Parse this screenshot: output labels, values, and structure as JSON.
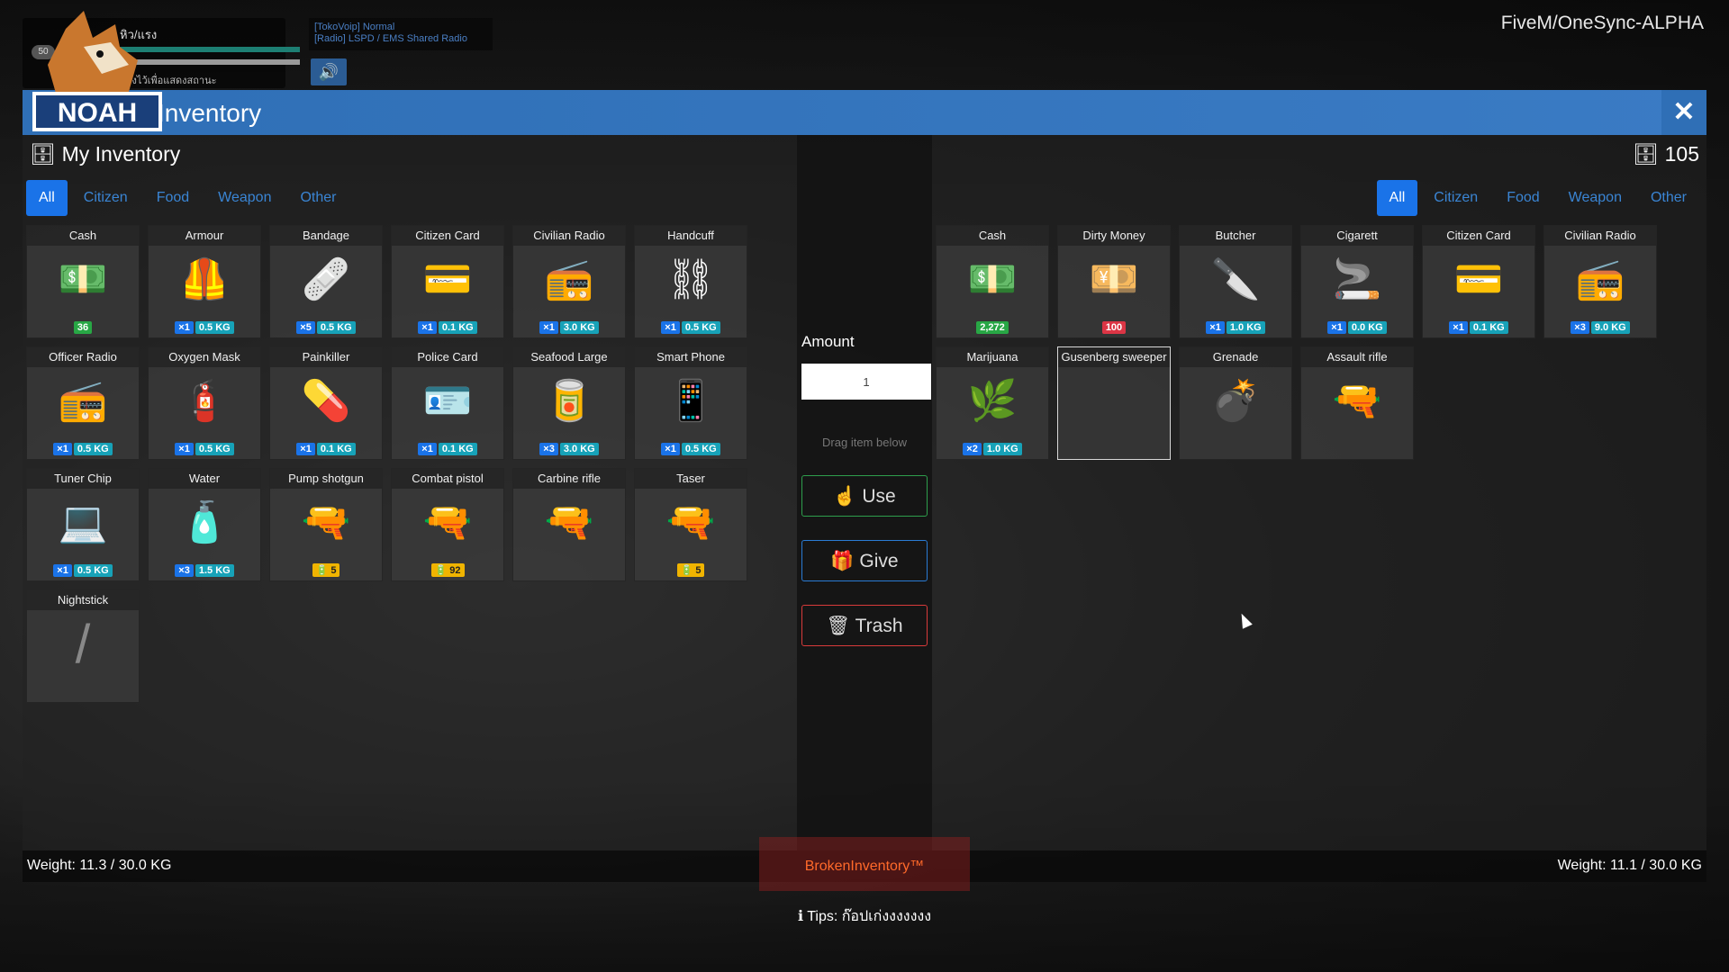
{
  "hud": {
    "hunger_label": "หิว/แรง",
    "mic_label": "50",
    "status_text": "ค้างไว้เพื่อแสดงสถานะ",
    "radio_line1": "[TokoVoip] Normal",
    "radio_line2": "[Radio] LSPD / EMS Shared Radio",
    "speaker_icon": "speaker-icon",
    "server_name": "FiveM/OneSync-ALPHA"
  },
  "window": {
    "logo_text": "NOAH",
    "title": "Inventory",
    "close_label": "✕"
  },
  "left": {
    "title": "My Inventory",
    "tabs": [
      "All",
      "Citizen",
      "Food",
      "Weapon",
      "Other"
    ],
    "active_tab": "All",
    "items": [
      {
        "name": "Cash",
        "icon": "cash-icon",
        "glyph": "💵",
        "badges": [
          {
            "t": "green",
            "v": "36"
          }
        ]
      },
      {
        "name": "Armour",
        "icon": "armour-icon",
        "glyph": "🦺",
        "badges": [
          {
            "t": "qty",
            "v": "×1"
          },
          {
            "t": "kg",
            "v": "0.5 KG"
          }
        ]
      },
      {
        "name": "Bandage",
        "icon": "bandage-icon",
        "glyph": "🩹",
        "badges": [
          {
            "t": "qty",
            "v": "×5"
          },
          {
            "t": "kg",
            "v": "0.5 KG"
          }
        ]
      },
      {
        "name": "Citizen Card",
        "icon": "card-icon",
        "glyph": "💳",
        "badges": [
          {
            "t": "qty",
            "v": "×1"
          },
          {
            "t": "kg",
            "v": "0.1 KG"
          }
        ]
      },
      {
        "name": "Civilian Radio",
        "icon": "radio-icon",
        "glyph": "📻",
        "badges": [
          {
            "t": "qty",
            "v": "×1"
          },
          {
            "t": "kg",
            "v": "3.0 KG"
          }
        ]
      },
      {
        "name": "Handcuff",
        "icon": "handcuff-icon",
        "glyph": "⛓",
        "badges": [
          {
            "t": "qty",
            "v": "×1"
          },
          {
            "t": "kg",
            "v": "0.5 KG"
          }
        ]
      },
      {
        "name": "Officer Radio",
        "icon": "radio-icon",
        "glyph": "📻",
        "badges": [
          {
            "t": "qty",
            "v": "×1"
          },
          {
            "t": "kg",
            "v": "0.5 KG"
          }
        ]
      },
      {
        "name": "Oxygen Mask",
        "icon": "oxygen-icon",
        "glyph": "🧯",
        "badges": [
          {
            "t": "qty",
            "v": "×1"
          },
          {
            "t": "kg",
            "v": "0.5 KG"
          }
        ]
      },
      {
        "name": "Painkiller",
        "icon": "pill-icon",
        "glyph": "💊",
        "badges": [
          {
            "t": "qty",
            "v": "×1"
          },
          {
            "t": "kg",
            "v": "0.1 KG"
          }
        ]
      },
      {
        "name": "Police Card",
        "icon": "card-icon",
        "glyph": "🪪",
        "badges": [
          {
            "t": "qty",
            "v": "×1"
          },
          {
            "t": "kg",
            "v": "0.1 KG"
          }
        ]
      },
      {
        "name": "Seafood Large",
        "icon": "food-icon",
        "glyph": "🥫",
        "badges": [
          {
            "t": "qty",
            "v": "×3"
          },
          {
            "t": "kg",
            "v": "3.0 KG"
          }
        ]
      },
      {
        "name": "Smart Phone",
        "icon": "phone-icon",
        "glyph": "📱",
        "badges": [
          {
            "t": "qty",
            "v": "×1"
          },
          {
            "t": "kg",
            "v": "0.5 KG"
          }
        ]
      },
      {
        "name": "Tuner Chip",
        "icon": "chip-icon",
        "glyph": "💻",
        "badges": [
          {
            "t": "qty",
            "v": "×1"
          },
          {
            "t": "kg",
            "v": "0.5 KG"
          }
        ]
      },
      {
        "name": "Water",
        "icon": "water-icon",
        "glyph": "🧴",
        "badges": [
          {
            "t": "qty",
            "v": "×3"
          },
          {
            "t": "kg",
            "v": "1.5 KG"
          }
        ]
      },
      {
        "name": "Pump shotgun",
        "icon": "shotgun-icon",
        "glyph": "🔫",
        "badges": [
          {
            "t": "ammo",
            "v": "🔋 5"
          }
        ]
      },
      {
        "name": "Combat pistol",
        "icon": "pistol-icon",
        "glyph": "🔫",
        "badges": [
          {
            "t": "ammo",
            "v": "🔋 92"
          }
        ]
      },
      {
        "name": "Carbine rifle",
        "icon": "rifle-icon",
        "glyph": "🔫",
        "badges": []
      },
      {
        "name": "Taser",
        "icon": "taser-icon",
        "glyph": "🔫",
        "badges": [
          {
            "t": "ammo",
            "v": "🔋 5"
          }
        ]
      },
      {
        "name": "Nightstick",
        "icon": "nightstick-icon",
        "glyph": "/",
        "badges": []
      }
    ],
    "weight": "Weight: 11.3 / 30.0 KG"
  },
  "middle": {
    "amount_label": "Amount",
    "amount_value": "1",
    "hint": "Drag item below",
    "use_label": "Use",
    "give_label": "Give",
    "trash_label": "Trash"
  },
  "right": {
    "count": "105",
    "tabs": [
      "All",
      "Citizen",
      "Food",
      "Weapon",
      "Other"
    ],
    "active_tab": "All",
    "items": [
      {
        "name": "Cash",
        "icon": "cash-icon",
        "glyph": "💵",
        "badges": [
          {
            "t": "green",
            "v": "2,272"
          }
        ]
      },
      {
        "name": "Dirty Money",
        "icon": "dirty-money-icon",
        "glyph": "💴",
        "badges": [
          {
            "t": "red",
            "v": "100"
          }
        ]
      },
      {
        "name": "Butcher",
        "icon": "cleaver-icon",
        "glyph": "🔪",
        "badges": [
          {
            "t": "qty",
            "v": "×1"
          },
          {
            "t": "kg",
            "v": "1.0 KG"
          }
        ]
      },
      {
        "name": "Cigarett",
        "icon": "cigarette-icon",
        "glyph": "🚬",
        "badges": [
          {
            "t": "qty",
            "v": "×1"
          },
          {
            "t": "kg",
            "v": "0.0 KG"
          }
        ]
      },
      {
        "name": "Citizen Card",
        "icon": "card-icon",
        "glyph": "💳",
        "badges": [
          {
            "t": "qty",
            "v": "×1"
          },
          {
            "t": "kg",
            "v": "0.1 KG"
          }
        ]
      },
      {
        "name": "Civilian Radio",
        "icon": "radio-icon",
        "glyph": "📻",
        "badges": [
          {
            "t": "qty",
            "v": "×3"
          },
          {
            "t": "kg",
            "v": "9.0 KG"
          }
        ]
      },
      {
        "name": "Marijuana",
        "icon": "weed-icon",
        "glyph": "🌿",
        "badges": [
          {
            "t": "qty",
            "v": "×2"
          },
          {
            "t": "kg",
            "v": "1.0 KG"
          }
        ]
      },
      {
        "name": "Gusenberg sweeper",
        "icon": "broken-image-icon",
        "glyph": "",
        "badges": [],
        "selected": true
      },
      {
        "name": "Grenade",
        "icon": "grenade-icon",
        "glyph": "💣",
        "badges": []
      },
      {
        "name": "Assault rifle",
        "icon": "rifle-icon",
        "glyph": "🔫",
        "badges": []
      }
    ],
    "weight": "Weight: 11.1 / 30.0 KG"
  },
  "branding": "BrokenInventory™",
  "tips": "Tips: ก๊อปเก่งงงงงงง",
  "colors": {
    "accent": "#1a73e8",
    "titlebar": "#2f6fb6",
    "use": "#2e9e4c",
    "trash": "#d83a3a"
  }
}
